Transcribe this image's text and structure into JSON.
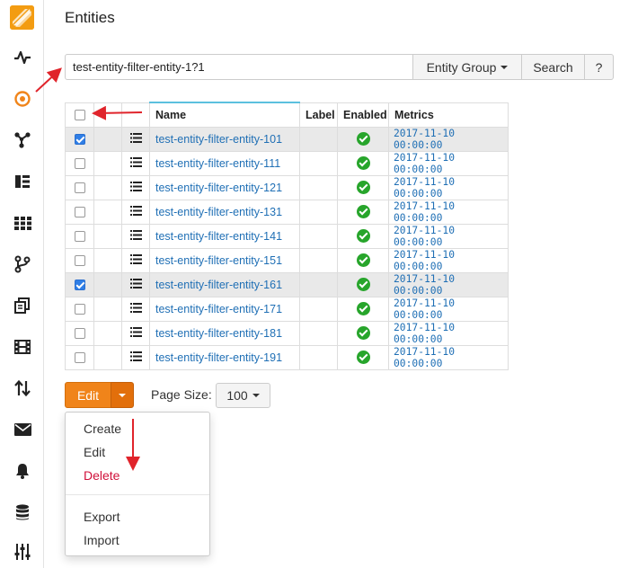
{
  "page": {
    "title": "Entities"
  },
  "search": {
    "value": "test-entity-filter-entity-1?1",
    "group_label": "Entity Group",
    "search_label": "Search",
    "help_label": "?"
  },
  "table": {
    "columns": {
      "name": "Name",
      "label": "Label",
      "enabled": "Enabled",
      "metrics": "Metrics"
    },
    "rows": [
      {
        "name": "test-entity-filter-entity-101",
        "label": "",
        "enabled": true,
        "metrics": "2017-11-10 00:00:00",
        "selected": true
      },
      {
        "name": "test-entity-filter-entity-111",
        "label": "",
        "enabled": true,
        "metrics": "2017-11-10 00:00:00",
        "selected": false
      },
      {
        "name": "test-entity-filter-entity-121",
        "label": "",
        "enabled": true,
        "metrics": "2017-11-10 00:00:00",
        "selected": false
      },
      {
        "name": "test-entity-filter-entity-131",
        "label": "",
        "enabled": true,
        "metrics": "2017-11-10 00:00:00",
        "selected": false
      },
      {
        "name": "test-entity-filter-entity-141",
        "label": "",
        "enabled": true,
        "metrics": "2017-11-10 00:00:00",
        "selected": false
      },
      {
        "name": "test-entity-filter-entity-151",
        "label": "",
        "enabled": true,
        "metrics": "2017-11-10 00:00:00",
        "selected": false
      },
      {
        "name": "test-entity-filter-entity-161",
        "label": "",
        "enabled": true,
        "metrics": "2017-11-10 00:00:00",
        "selected": true
      },
      {
        "name": "test-entity-filter-entity-171",
        "label": "",
        "enabled": true,
        "metrics": "2017-11-10 00:00:00",
        "selected": false
      },
      {
        "name": "test-entity-filter-entity-181",
        "label": "",
        "enabled": true,
        "metrics": "2017-11-10 00:00:00",
        "selected": false
      },
      {
        "name": "test-entity-filter-entity-191",
        "label": "",
        "enabled": true,
        "metrics": "2017-11-10 00:00:00",
        "selected": false
      }
    ]
  },
  "toolbar": {
    "edit_label": "Edit",
    "page_size_label": "Page Size:",
    "page_size_value": "100"
  },
  "menu": {
    "items": [
      "Create",
      "Edit",
      "Delete",
      "Export",
      "Import"
    ]
  },
  "colors": {
    "accent": "#f0841a",
    "link": "#1f6fb5",
    "danger": "#d0103a",
    "ok": "#27a52b",
    "annotation": "#e0242b"
  },
  "sidebar": {
    "icons": [
      "logo-icon",
      "pulse-icon",
      "target-icon",
      "share-icon",
      "list-icon",
      "grid-icon",
      "git-branch-icon",
      "copy-icon",
      "film-icon",
      "sort-icon",
      "mail-icon",
      "bell-icon",
      "database-icon",
      "sliders-icon"
    ]
  }
}
